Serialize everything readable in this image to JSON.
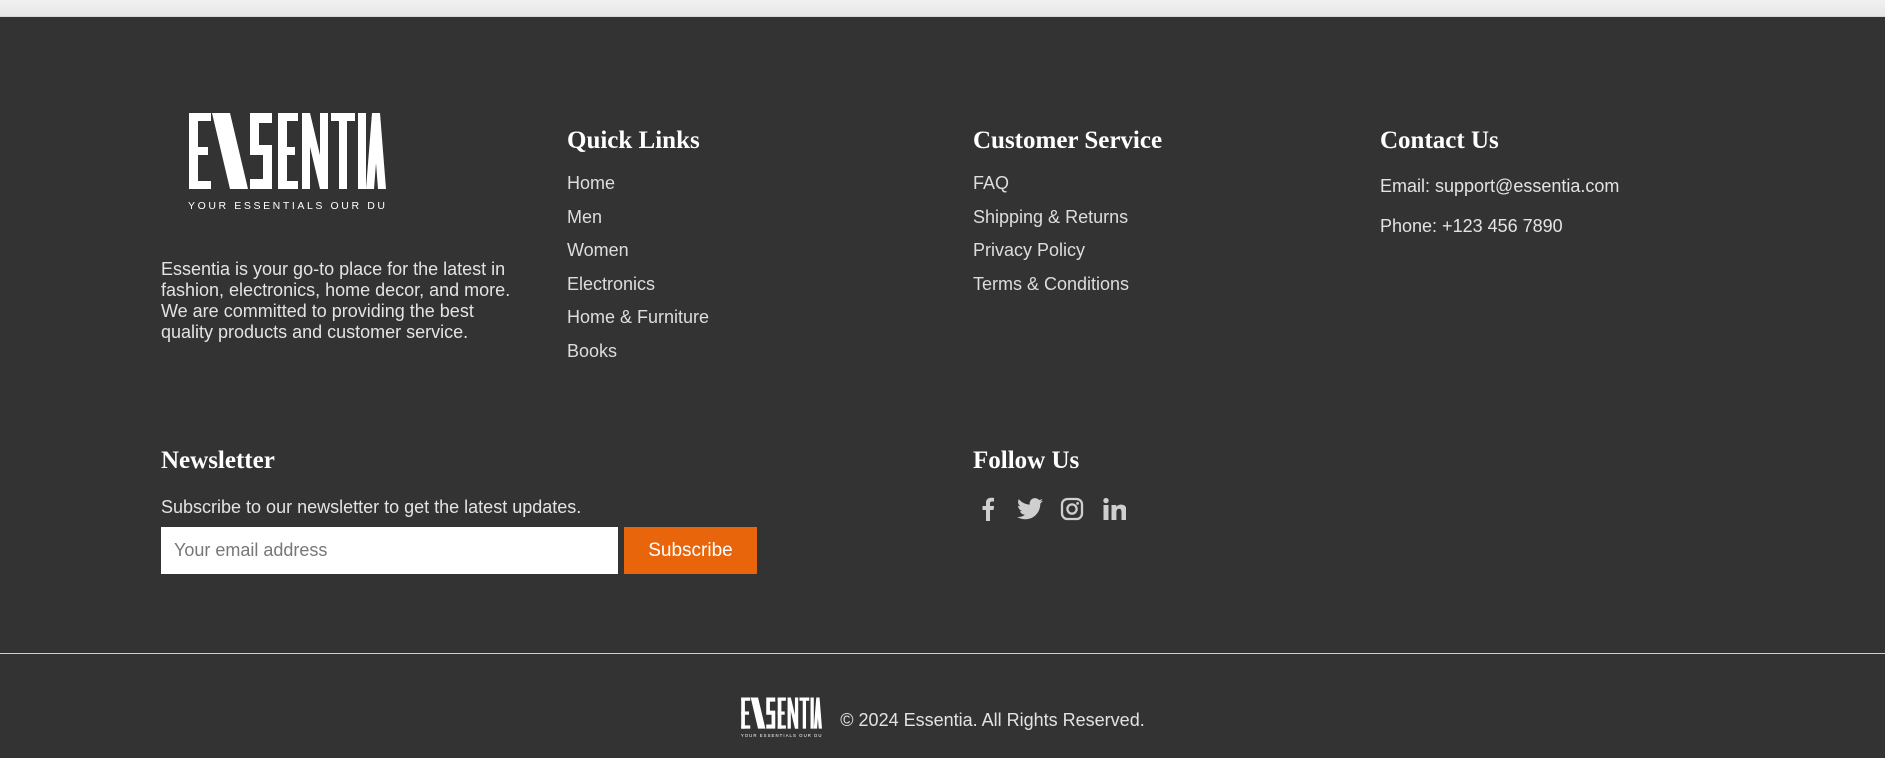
{
  "brand": {
    "logo_text": "ESSENTIA",
    "tagline": "YOUR ESSENTIALS OUR DUTY",
    "description": "Essentia is your go-to place for the latest in fashion, electronics, home decor, and more. We are committed to providing the best quality products and customer service."
  },
  "quick_links": {
    "title": "Quick Links",
    "items": [
      "Home",
      "Men",
      "Women",
      "Electronics",
      "Home & Furniture",
      "Books"
    ]
  },
  "customer_service": {
    "title": "Customer Service",
    "items": [
      "FAQ",
      "Shipping & Returns",
      "Privacy Policy",
      "Terms & Conditions"
    ]
  },
  "contact": {
    "title": "Contact Us",
    "email": "Email: support@essentia.com",
    "phone": "Phone: +123 456 7890"
  },
  "newsletter": {
    "title": "Newsletter",
    "text": "Subscribe to our newsletter to get the latest updates.",
    "placeholder": "Your email address",
    "button_label": "Subscribe"
  },
  "follow": {
    "title": "Follow Us",
    "icons": [
      "facebook-icon",
      "twitter-icon",
      "instagram-icon",
      "linkedin-icon"
    ]
  },
  "copyright": "© 2024 Essentia. All Rights Reserved.",
  "colors": {
    "footer_bg": "#333333",
    "accent": "#e8650c",
    "text": "#e3e3e3",
    "heading": "#ffffff"
  }
}
